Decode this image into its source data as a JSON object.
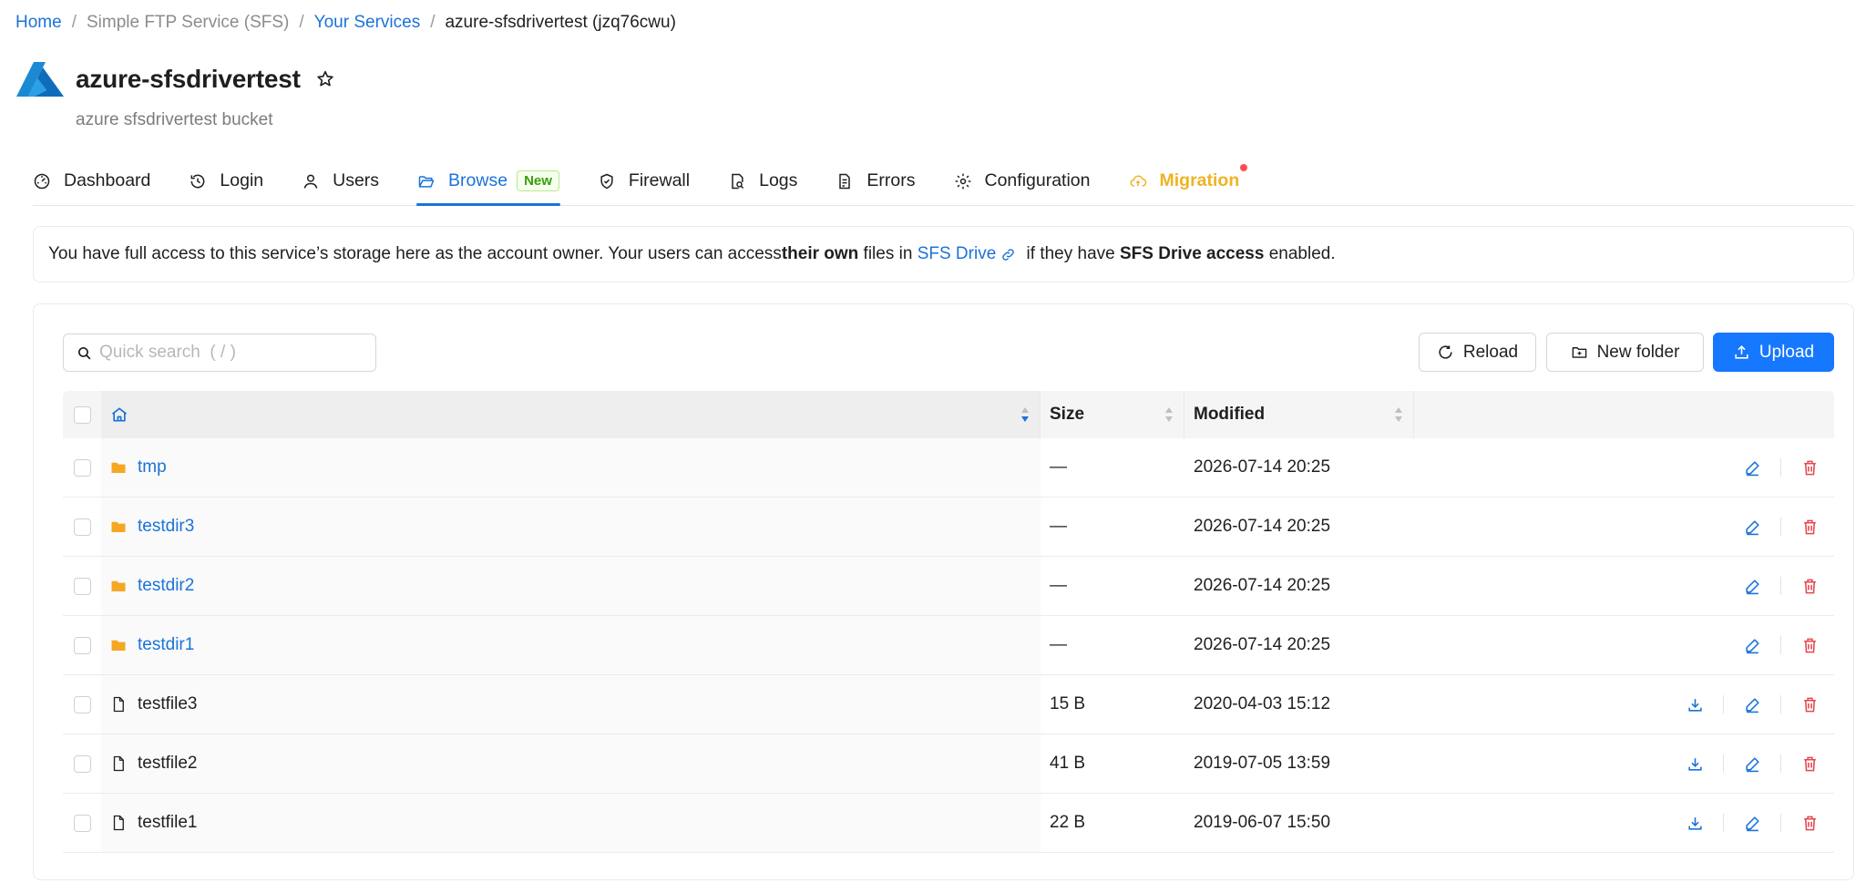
{
  "breadcrumb": {
    "home": "Home",
    "product": "Simple FTP Service (SFS)",
    "services": "Your Services",
    "current": "azure-sfsdrivertest (jzq76cwu)"
  },
  "header": {
    "title": "azure-sfsdrivertest",
    "subtitle": "azure sfsdrivertest bucket"
  },
  "tabs": [
    {
      "label": "Dashboard",
      "icon": "dashboard-icon"
    },
    {
      "label": "Login",
      "icon": "login-icon"
    },
    {
      "label": "Users",
      "icon": "user-icon"
    },
    {
      "label": "Browse",
      "icon": "folder-open-icon",
      "badge": "New",
      "active": true
    },
    {
      "label": "Firewall",
      "icon": "shield-icon"
    },
    {
      "label": "Logs",
      "icon": "file-search-icon"
    },
    {
      "label": "Errors",
      "icon": "file-error-icon"
    },
    {
      "label": "Configuration",
      "icon": "gear-icon"
    },
    {
      "label": "Migration",
      "icon": "cloud-sync-icon",
      "dot": true
    }
  ],
  "notice": {
    "part1": "You have full access to this service’s storage here as the account owner. Your users can access ",
    "bold1": "their own",
    "part2": " files in ",
    "link": "SFS Drive",
    "part3": " if they have ",
    "bold2": "SFS Drive access",
    "part4": " enabled."
  },
  "toolbar": {
    "search_placeholder": "Quick search  ( / )",
    "reload": "Reload",
    "new_folder": "New folder",
    "upload": "Upload"
  },
  "table": {
    "columns": {
      "size": "Size",
      "modified": "Modified"
    },
    "rows": [
      {
        "name": "tmp",
        "type": "folder",
        "size": "—",
        "modified": "2026-07-14 20:25"
      },
      {
        "name": "testdir3",
        "type": "folder",
        "size": "—",
        "modified": "2026-07-14 20:25"
      },
      {
        "name": "testdir2",
        "type": "folder",
        "size": "—",
        "modified": "2026-07-14 20:25"
      },
      {
        "name": "testdir1",
        "type": "folder",
        "size": "—",
        "modified": "2026-07-14 20:25"
      },
      {
        "name": "testfile3",
        "type": "file",
        "size": "15 B",
        "modified": "2020-04-03 15:12"
      },
      {
        "name": "testfile2",
        "type": "file",
        "size": "41 B",
        "modified": "2019-07-05 13:59"
      },
      {
        "name": "testfile1",
        "type": "file",
        "size": "22 B",
        "modified": "2019-06-07 15:50"
      }
    ]
  },
  "colors": {
    "accent": "#1677ff",
    "link": "#1a73d9",
    "folder": "#f5a623",
    "delete": "#e5484d",
    "migration": "#f0b323",
    "badge_green": "#389e0d"
  }
}
